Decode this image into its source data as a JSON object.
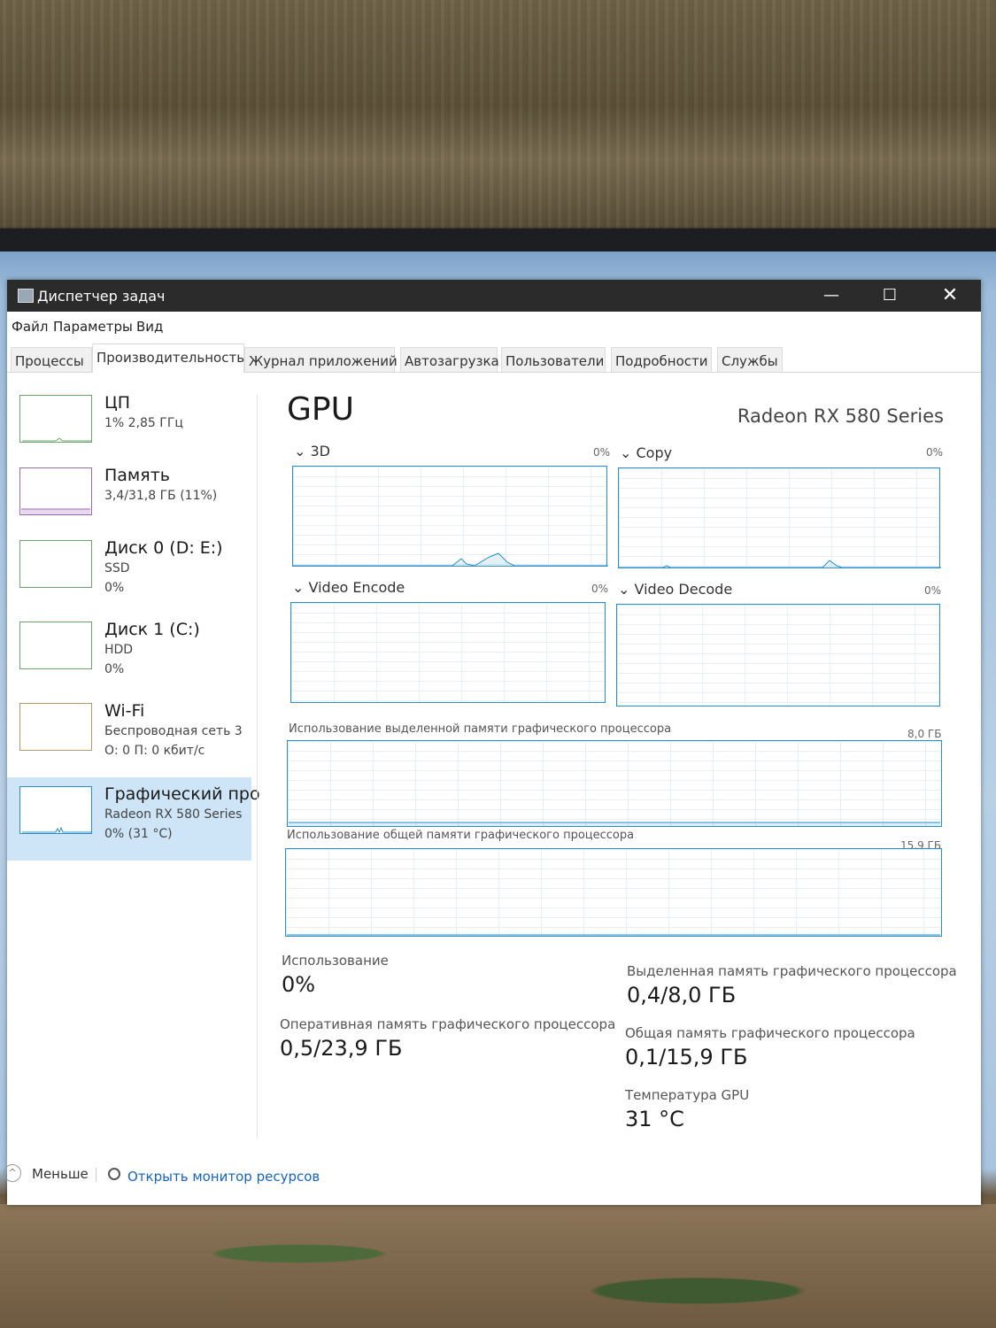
{
  "window": {
    "title": "Диспетчер задач",
    "controls": {
      "minimize": "—",
      "maximize": "☐",
      "close": "✕"
    }
  },
  "menu": [
    "Файл",
    "Параметры",
    "Вид"
  ],
  "tabs": [
    "Процессы",
    "Производительность",
    "Журнал приложений",
    "Автозагрузка",
    "Пользователи",
    "Подробности",
    "Службы"
  ],
  "active_tab": "Производительность",
  "sidebar": {
    "items": [
      {
        "name": "ЦП",
        "sub1": "1% 2,85 ГГц",
        "sub2": ""
      },
      {
        "name": "Память",
        "sub1": "3,4/31,8 ГБ (11%)",
        "sub2": ""
      },
      {
        "name": "Диск 0 (D: E:)",
        "sub1": "SSD",
        "sub2": "0%"
      },
      {
        "name": "Диск 1 (C:)",
        "sub1": "HDD",
        "sub2": "0%"
      },
      {
        "name": "Wi-Fi",
        "sub1": "Беспроводная сеть 3",
        "sub2": "О: 0 П: 0 кбит/с"
      },
      {
        "name": "Графический про",
        "sub1": "Radeon RX 580 Series",
        "sub2": "0% (31 °C)"
      }
    ],
    "selected_index": 5
  },
  "gpu": {
    "title": "GPU",
    "model": "Radeon RX 580 Series",
    "engines": [
      {
        "label": "⌄ 3D",
        "percent": "0%"
      },
      {
        "label": "⌄ Copy",
        "percent": "0%"
      },
      {
        "label": "⌄ Video Encode",
        "percent": "0%"
      },
      {
        "label": "⌄ Video Decode",
        "percent": "0%"
      }
    ],
    "dedicated_memory": {
      "label": "Использование выделенной памяти графического процессора",
      "max": "8,0 ГБ"
    },
    "shared_memory": {
      "label": "Использование общей памяти графического процессора",
      "max": "15,9 ГБ"
    },
    "stats": {
      "usage_label": "Использование",
      "usage_value": "0%",
      "gpu_ram_label": "Оперативная память графического процессора",
      "gpu_ram_value": "0,5/23,9 ГБ",
      "dedicated_label": "Выделенная память графического процессора",
      "dedicated_value": "0,4/8,0 ГБ",
      "shared_label": "Общая память графического процессора",
      "shared_value": "0,1/15,9 ГБ",
      "temp_label": "Температура GPU",
      "temp_value": "31 °C"
    }
  },
  "footer": {
    "less_label": "Меньше",
    "resource_monitor_label": "Открыть монитор ресурсов"
  },
  "colors": {
    "accent": "#2a8fc9",
    "selected_bg": "#cde5f7",
    "titlebar_bg": "#2b2b2b",
    "link": "#1565c0"
  },
  "icons": {
    "app": "task-manager-icon",
    "less": "chevron-up-icon",
    "resource_monitor": "resource-monitor-icon"
  }
}
